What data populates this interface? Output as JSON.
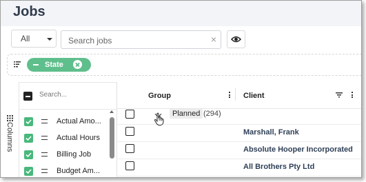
{
  "page": {
    "title": "Jobs"
  },
  "toolbar": {
    "filter_value": "All",
    "search_placeholder": "Search jobs",
    "clear_glyph": "×"
  },
  "filters": {
    "chips": [
      {
        "label": "State"
      }
    ]
  },
  "columns_panel": {
    "tab_label": "Columns",
    "search_placeholder": "Search...",
    "items": [
      {
        "label": "Actual Amo...",
        "checked": true
      },
      {
        "label": "Actual Hours",
        "checked": true
      },
      {
        "label": "Billing Job",
        "checked": true
      },
      {
        "label": "Budget Am...",
        "checked": true
      }
    ]
  },
  "grid": {
    "headers": {
      "group": "Group",
      "client": "Client"
    },
    "group_row": {
      "label": "Planned",
      "count": "(294)"
    },
    "rows": [
      {
        "client": "Marshall, Frank"
      },
      {
        "client": "Absolute Hooper Incorporated"
      },
      {
        "client": "All Brothers Pty Ltd"
      }
    ]
  },
  "colors": {
    "accent_green": "#5fbf8c",
    "checkbox_green": "#48b87b",
    "header_bg": "#f3f4f7",
    "title_text": "#2f3b4c"
  },
  "icons": [
    "caret-down-icon",
    "eye-icon",
    "filter-list-icon",
    "close-icon",
    "grid-icon",
    "drag-handle-icon",
    "kebab-menu-icon",
    "filter-icon",
    "chevron-down-icon",
    "hand-cursor-icon"
  ]
}
